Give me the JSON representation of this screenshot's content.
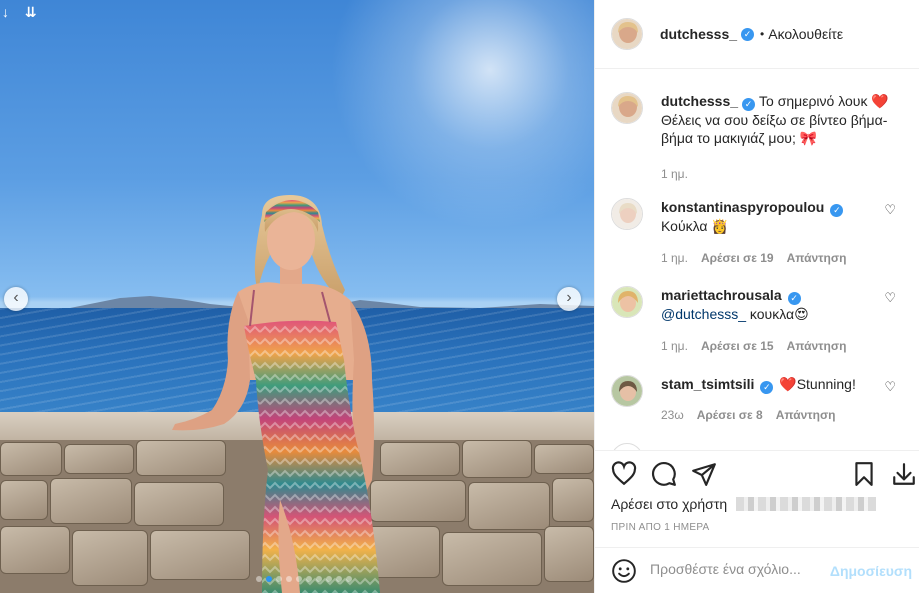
{
  "header": {
    "username": "dutchesss_",
    "separator": "•",
    "follow_label": "Ακολουθείτε"
  },
  "caption": {
    "username": "dutchesss_",
    "text": "Το σημερινό λουκ ❤️ Θέλεις να σου δείξω σε βίντεο βήμα-βήμα το μακιγιάζ μου; 🎀",
    "age": "1 ημ."
  },
  "comments": [
    {
      "username": "konstantinaspyropoulou",
      "text": "Κούκλα 👸",
      "age": "1 ημ.",
      "likes": "Αρέσει σε 19",
      "reply": "Απάντηση"
    },
    {
      "username": "mariettachrousala",
      "mention": "@dutchesss_",
      "text": " κουκλα😍",
      "age": "1 ημ.",
      "likes": "Αρέσει σε 15",
      "reply": "Απάντηση"
    },
    {
      "username": "stam_tsimtsili",
      "text": "❤️Stunning!",
      "age": "23ω",
      "likes": "Αρέσει σε 8",
      "reply": "Απάντηση"
    }
  ],
  "actions": {
    "liked_by_label": "Αρέσει στο χρήστη",
    "timestamp": "ΠΡΙΝ ΑΠΟ 1 ΗΜΕΡΑ"
  },
  "comment_box": {
    "placeholder": "Προσθέστε ένα σχόλιο...",
    "post_label": "Δημοσίευση"
  },
  "carousel": {
    "prev_arrow": "‹",
    "next_arrow": "›",
    "total_slides": 10,
    "active_slide": 2
  },
  "colors": {
    "verified": "#3897f0",
    "link": "#00376b",
    "post_disabled": "#b2dffc",
    "muted": "#8e8e8e"
  }
}
